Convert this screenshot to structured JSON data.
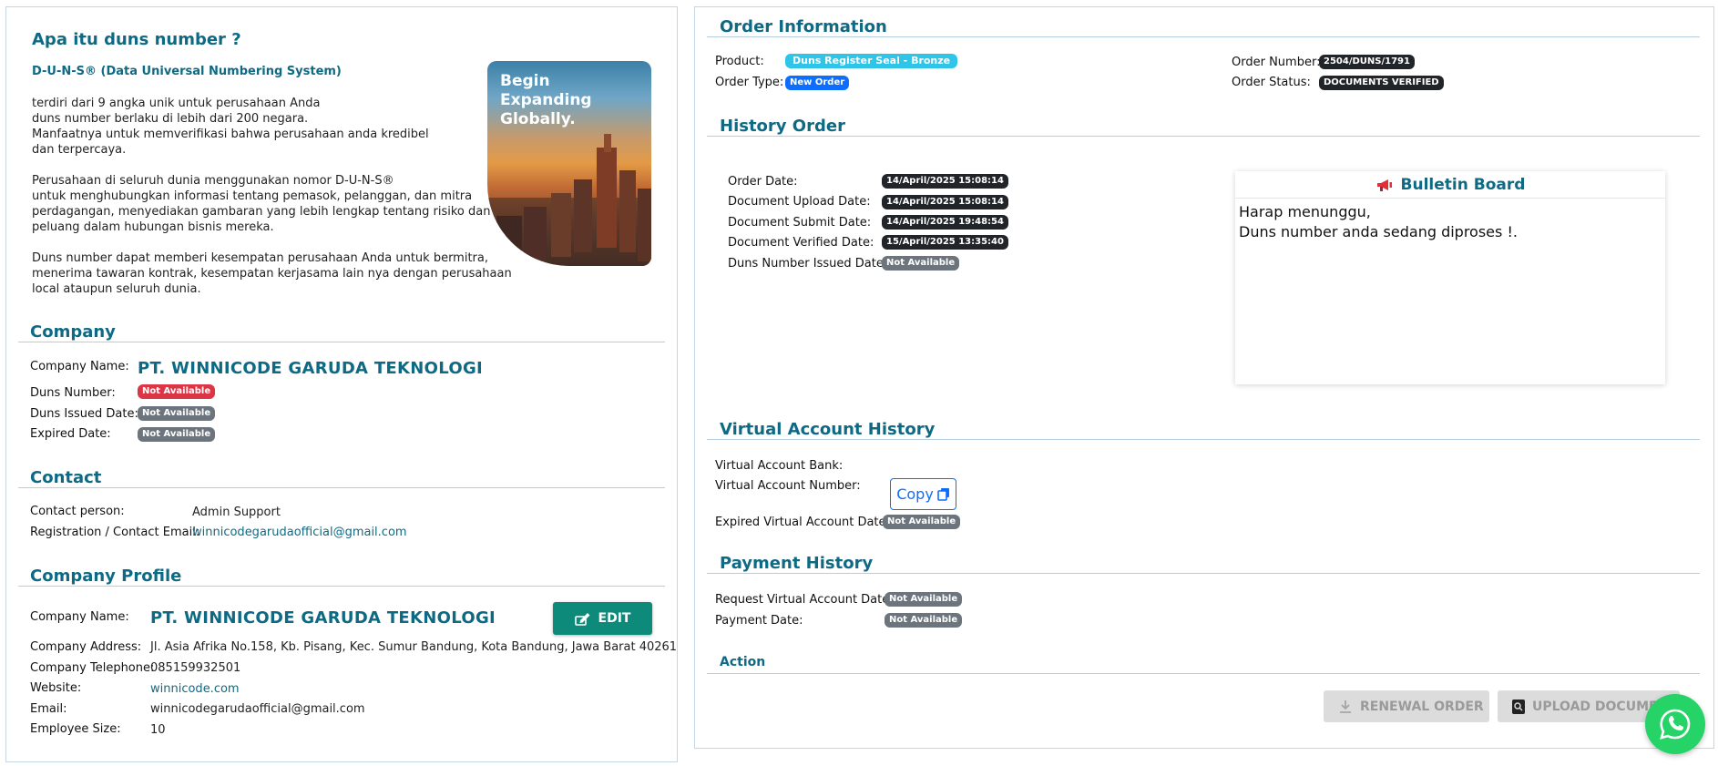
{
  "intro": {
    "title": "Apa itu duns number ?",
    "subtitle": "D-U-N-S® (Data Universal Numbering System)",
    "p1": [
      "terdiri dari 9 angka unik untuk perusahaan Anda",
      "duns number berlaku di lebih dari 200 negara.",
      "Manfaatnya untuk memverifikasi bahwa perusahaan anda kredibel",
      "dan terpercaya."
    ],
    "p2": [
      "Perusahaan di seluruh dunia menggunakan nomor D-U-N-S®",
      "untuk menghubungkan informasi tentang pemasok, pelanggan, dan mitra",
      "perdagangan, menyediakan gambaran yang lebih lengkap tentang risiko dan",
      "peluang dalam hubungan bisnis mereka."
    ],
    "p3": [
      "Duns number dapat memberi kesempatan perusahaan Anda untuk bermitra,",
      "menerima tawaran kontrak, kesempatan kerjasama lain nya dengan perusahaan",
      "local ataupun seluruh dunia."
    ],
    "promo_lines": [
      "Begin",
      "Expanding",
      "Globally."
    ]
  },
  "company": {
    "heading": "Company",
    "name_label": "Company Name:",
    "name": "PT. WINNICODE GARUDA TEKNOLOGI",
    "duns_label": "Duns Number:",
    "duns_value": "Not Available",
    "issued_label": "Duns Issued Date:",
    "issued_value": "Not Available",
    "expired_label": "Expired Date:",
    "expired_value": "Not Available"
  },
  "contact": {
    "heading": "Contact",
    "person_label": "Contact person:",
    "person": "Admin Support",
    "email_label": "Registration / Contact Email:",
    "email": "winnicodegarudaofficial@gmail.com"
  },
  "profile": {
    "heading": "Company Profile",
    "name_label": "Company Name:",
    "name": "PT. WINNICODE GARUDA TEKNOLOGI",
    "edit_label": "EDIT",
    "address_label": "Company Address:",
    "address": "Jl. Asia Afrika No.158, Kb. Pisang, Kec. Sumur Bandung, Kota Bandung, Jawa Barat 40261",
    "phone_label": "Company Telephone:",
    "phone": "085159932501",
    "website_label": "Website:",
    "website": "winnicode.com",
    "email_label": "Email:",
    "email": "winnicodegarudaofficial@gmail.com",
    "size_label": "Employee Size:",
    "size": "10"
  },
  "order": {
    "heading": "Order Information",
    "product_label": "Product:",
    "product": "Duns Register Seal - Bronze",
    "type_label": "Order Type:",
    "type": "New Order",
    "number_label": "Order Number:",
    "number": "2504/DUNS/1791",
    "status_label": "Order Status:",
    "status": "DOCUMENTS VERIFIED"
  },
  "history": {
    "heading": "History Order",
    "rows": [
      {
        "label": "Order Date:",
        "value": "14/April/2025 15:08:14"
      },
      {
        "label": "Document Upload Date:",
        "value": "14/April/2025 15:08:14"
      },
      {
        "label": "Document Submit Date:",
        "value": "14/April/2025 19:48:54"
      },
      {
        "label": "Document Verified Date:",
        "value": "15/April/2025 13:35:40"
      },
      {
        "label": "Duns Number Issued Date:",
        "value": "Not Available"
      }
    ]
  },
  "bulletin": {
    "title": "Bulletin Board",
    "body": "Harap menunggu,\nDuns number anda sedang diproses !."
  },
  "va": {
    "heading": "Virtual Account History",
    "bank_label": "Virtual Account Bank:",
    "number_label": "Virtual Account Number:",
    "copy_label": "Copy",
    "expired_label": "Expired Virtual Account Date:",
    "expired_value": "Not Available"
  },
  "payment": {
    "heading": "Payment History",
    "request_label": "Request Virtual Account Date:",
    "request_value": "Not Available",
    "date_label": "Payment Date:",
    "date_value": "Not Available"
  },
  "action": {
    "heading": "Action",
    "renewal_label": "RENEWAL ORDER",
    "upload_label": "UPLOAD DOCUMENT"
  },
  "colors": {
    "accent": "#0e6a84",
    "edit": "#0d8a7a",
    "whatsapp": "#25d366"
  }
}
